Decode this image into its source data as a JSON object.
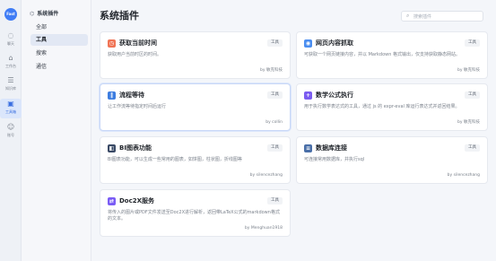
{
  "rail": {
    "logo": "Fast",
    "items": [
      {
        "label": "聊天",
        "icon": "chat-icon",
        "glyph": "◌",
        "active": false
      },
      {
        "label": "工作台",
        "icon": "workbench-icon",
        "glyph": "⌂",
        "active": false
      },
      {
        "label": "知识库",
        "icon": "database-icon",
        "glyph": "☰",
        "active": false
      },
      {
        "label": "工具箱",
        "icon": "toolbox-icon",
        "glyph": "▣",
        "active": true
      },
      {
        "label": "账号",
        "icon": "account-icon",
        "glyph": "☺",
        "active": false
      }
    ]
  },
  "subnav": {
    "header": "系统插件",
    "header_icon": "plugin-icon",
    "items": [
      {
        "label": "全部",
        "active": false
      },
      {
        "label": "工具",
        "active": true
      },
      {
        "label": "搜索",
        "active": false
      },
      {
        "label": "通信",
        "active": false
      }
    ]
  },
  "page_title": "系统插件",
  "search": {
    "placeholder": "搜索插件",
    "value": ""
  },
  "cards": [
    {
      "title": "获取当前时间",
      "tag": "工具",
      "desc": "获取用户当前时区的时间。",
      "author": "by 敏克科技",
      "icon": "clock-icon",
      "glyph": "◷",
      "color": "#f07455",
      "selected": false
    },
    {
      "title": "网页内容抓取",
      "tag": "工具",
      "desc": "可获取一个网页链接内容，并以 Markdown 格式输出，仅支持获取静态网站。",
      "author": "by 敏克科技",
      "icon": "web-icon",
      "glyph": "◉",
      "color": "#4b8ef0",
      "selected": false
    },
    {
      "title": "流程等待",
      "tag": "工具",
      "desc": "让工作流等待指定时间后运行",
      "author": "by collin",
      "icon": "pause-icon",
      "glyph": "‖",
      "color": "#3d7de0",
      "selected": true
    },
    {
      "title": "数学公式执行",
      "tag": "工具",
      "desc": "用于执行数学表达式的工具，通过 js 的 expr-eval 库运行表达式并返回结果。",
      "author": "by 敏克科技",
      "icon": "math-icon",
      "glyph": "+",
      "color": "#7b5cf0",
      "selected": false
    },
    {
      "title": "BI图表功能",
      "tag": "工具",
      "desc": "BI图表功能，可以生成一些常用的图表，如饼图，柱状图，折线图等",
      "author": "by silencezhang",
      "icon": "chart-icon",
      "glyph": "◧",
      "color": "#3a4a66",
      "selected": false
    },
    {
      "title": "数据库连接",
      "tag": "工具",
      "desc": "可连接常用数据库，并执行sql",
      "author": "by silencezhang",
      "icon": "db-icon",
      "glyph": "≡",
      "color": "#4a6fa8",
      "selected": false
    },
    {
      "title": "Doc2X服务",
      "tag": "工具",
      "desc": "将传入的图片或PDF文件发送至Doc2X进行解析，返回带LaTeX公式的markdown格式的文本。",
      "author": "by Menghuan1918",
      "icon": "doc2x-icon",
      "glyph": "⇄",
      "color": "#7a5cf5",
      "selected": false
    }
  ]
}
